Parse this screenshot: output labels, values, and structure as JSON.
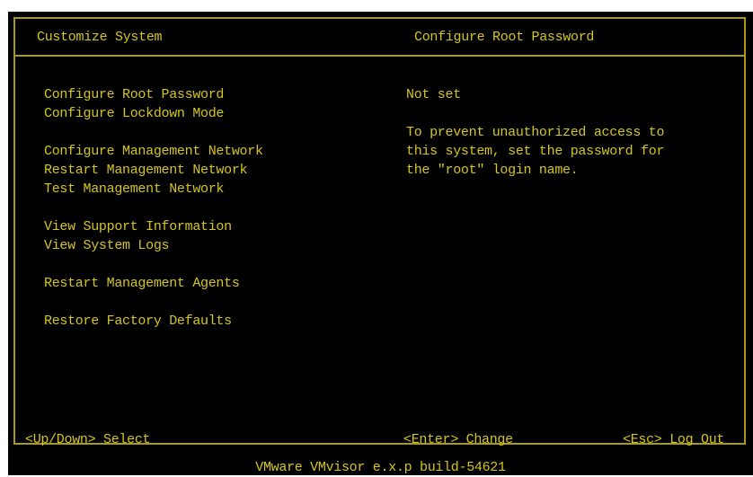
{
  "header": {
    "left_title": "Customize System",
    "right_title": "Configure Root Password"
  },
  "menu": {
    "items": [
      {
        "label": "Configure Root Password"
      },
      {
        "label": "Configure Lockdown Mode"
      },
      {
        "label": "Configure Management Network"
      },
      {
        "label": "Restart Management Network"
      },
      {
        "label": "Test Management Network"
      },
      {
        "label": "View Support Information"
      },
      {
        "label": "View System Logs"
      },
      {
        "label": "Restart Management Agents"
      },
      {
        "label": "Restore Factory Defaults"
      }
    ]
  },
  "detail": {
    "status": "Not set",
    "description_lines": [
      "To prevent unauthorized access to",
      "this system, set the password for",
      "the \"root\" login name."
    ]
  },
  "footer": {
    "select_hint": "<Up/Down> Select",
    "change_hint": "<Enter> Change",
    "logout_hint": "<Esc> Log Out"
  },
  "build_line": "VMware VMvisor e.x.p build-54621",
  "colors": {
    "background": "#000000",
    "text": "#d4c61e",
    "border": "#a89a16"
  }
}
